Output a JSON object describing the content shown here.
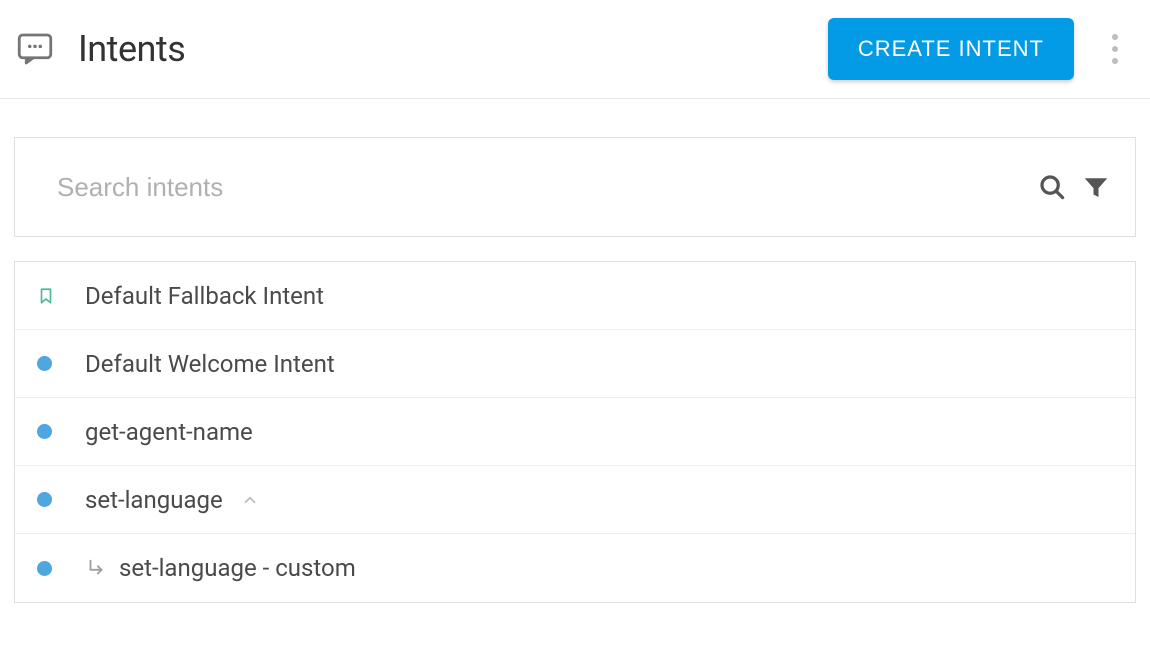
{
  "header": {
    "title": "Intents",
    "create_label": "CREATE INTENT"
  },
  "search": {
    "placeholder": "Search intents"
  },
  "intents": [
    {
      "label": "Default Fallback Intent",
      "icon": "bookmark",
      "indent": false,
      "expandable": false
    },
    {
      "label": "Default Welcome Intent",
      "icon": "dot",
      "indent": false,
      "expandable": false
    },
    {
      "label": "get-agent-name",
      "icon": "dot",
      "indent": false,
      "expandable": false
    },
    {
      "label": "set-language",
      "icon": "dot",
      "indent": false,
      "expandable": true
    },
    {
      "label": "set-language - custom",
      "icon": "dot",
      "indent": true,
      "expandable": false
    }
  ]
}
